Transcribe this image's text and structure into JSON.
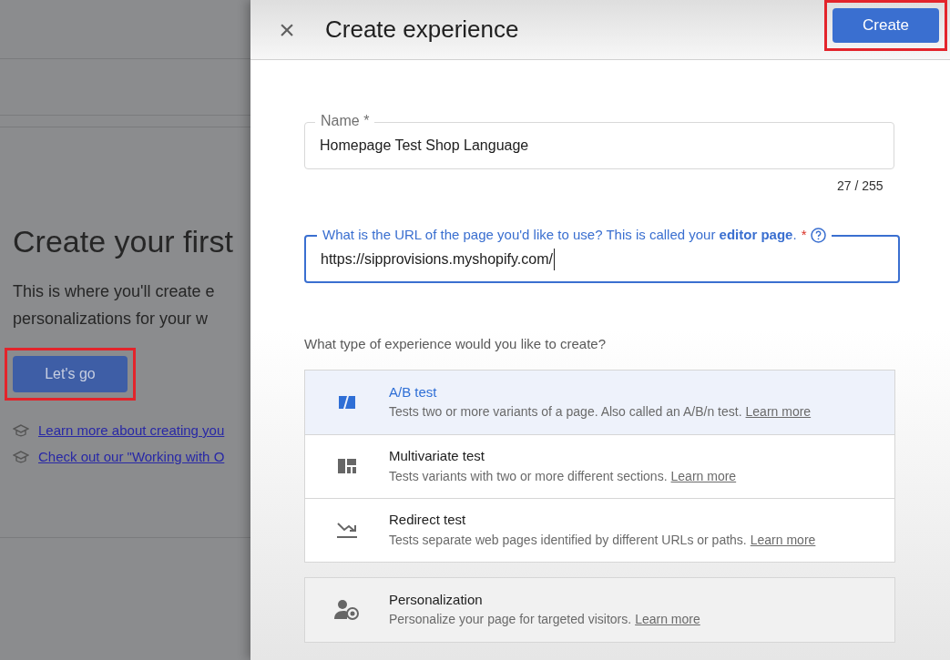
{
  "background_page": {
    "heading": "Create your first",
    "description_lines": [
      "This is where you'll create e",
      "personalizations for your w"
    ],
    "primary_button": {
      "label": "Let's go",
      "highlighted": true
    },
    "links": [
      "Learn more about creating you",
      "Check out our \"Working with O"
    ]
  },
  "panel": {
    "title": "Create experience",
    "close_label": "×",
    "create_button": {
      "label": "Create",
      "highlighted": true
    },
    "name_field": {
      "label": "Name *",
      "value": "Homepage Test Shop Language",
      "counter": "27 / 255",
      "focused": false
    },
    "url_field": {
      "label": "What is the URL of the page you'd like to use? This is called your **editor page**.",
      "required_mark": "*",
      "value": "https://sipprovisions.myshopify.com/",
      "focused": true
    },
    "type_question": "What type of experience would you like to create?",
    "experience_types": [
      {
        "kind": "ab",
        "title": "A/B test",
        "description": "Tests two or more variants of a page. Also called an A/B/n test.",
        "link": "Learn more",
        "selected": true
      },
      {
        "kind": "multivariate",
        "title": "Multivariate test",
        "description": "Tests variants with two or more different sections.",
        "link": "Learn more",
        "selected": false
      },
      {
        "kind": "redirect",
        "title": "Redirect test",
        "description": "Tests separate web pages identified by different URLs or paths.",
        "link": "Learn more",
        "selected": false
      }
    ],
    "personalization": {
      "kind": "personalization",
      "title": "Personalization",
      "description": "Personalize your page for targeted visitors.",
      "link": "Learn more",
      "selected": false
    }
  }
}
